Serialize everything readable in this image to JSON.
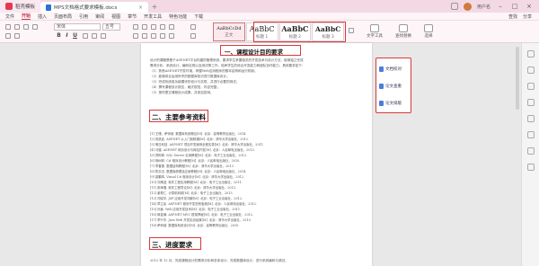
{
  "titlebar": {
    "app_name": "稻壳模板",
    "doc_name": "MPS文档格式要求模板.docx",
    "user_name": "用户名"
  },
  "menu": {
    "items": [
      "文件",
      "开始",
      "插入",
      "页面布局",
      "引用",
      "审阅",
      "视图",
      "章节",
      "开发工具",
      "特色功能",
      "下载"
    ],
    "active_index": 1,
    "right_items": [
      "查找",
      "分享"
    ]
  },
  "ribbon": {
    "font_name": "宋体",
    "font_size": "五号",
    "bold_label": "B",
    "italic_label": "I",
    "underline_label": "U",
    "styles": [
      {
        "sample": "AaBbCcDd",
        "name": "正文"
      },
      {
        "sample": "AaBbC",
        "name": "标题 1"
      },
      {
        "sample": "AaBbC",
        "name": "标题 2"
      },
      {
        "sample": "AaBbC",
        "name": "标题 3"
      }
    ],
    "right_tools": [
      "文字工具",
      "查找替换",
      "选择"
    ]
  },
  "document": {
    "section_top_title": "一、课程设计目的要求",
    "para1": [
      "设计的课题是基于ASP.NET平台构建的管理系统，要求学生掌握相关的开发技术与设计方法，能够独立完成",
      "需求分析、系统设计、编码实现以及测试等工作，培养学生的综合开发能力和团队协作能力，具体要求如下：",
      "（1）熟悉ASP.NET开发环境，掌握Web应用程序的基本结构和运行机制；",
      "（2）能够综合运用所学的数据库知识进行数据库设计；",
      "（3）完成系统各功能模块的设计与实现，并进行必要的测试；",
      "（4）撰写课程设计报告，格式规范，内容完整；",
      "（5）按时提交课程设计成果，并参加答辩。"
    ],
    "section2_title": "二、主要参考资料",
    "refs": [
      "[1] 王珊，萨师煊. 数据库系统概论[M]. 北京：高等教育出版社，2014.",
      "[2] 张跃廷. ASP.NET 从入门到精通[M]. 北京：清华大学出版社，2012.",
      "[3] 明日科技. ASP.NET 项目开发案例全程实录[M]. 北京：清华大学出版社，2011.",
      "[4] 马骏. ASP.NET 网页设计与网站开发[M]. 北京：人民邮电出版社，2013.",
      "[5] 郑阿奇. SQL Server 实用教程[M]. 北京：电子工业出版社，2012.",
      "[6] 杨树林. C# 程序设计教程[M]. 北京：人民邮电出版社，2010.",
      "[7] 李春葆. 数据结构教程[M]. 北京：清华大学出版社，2013.",
      "[8] 陈志泊. 数据库原理及应用教程[M]. 北京：人民邮电出版社，2014.",
      "[9] 邵鹏鸣. Visual C# 程序设计[M]. 北京：清华大学出版社，2012.",
      "[10] 刘甫迎. 软件工程实用教程[M]. 北京：电子工业出版社，2011.",
      "[11] 张海藩. 软件工程导论[M]. 北京：清华大学出版社，2013.",
      "[12] 谢希仁. 计算机网络[M]. 北京：电子工业出版社，2013.",
      "[13] 刘晓华. JSP 应用开发详解[M]. 北京：电子工业出版社，2012.",
      "[14] 章立民. ASP.NET 程序开发范例宝典[M]. 北京：人民邮电出版社，2012.",
      "[15] 孙鑫. Web 应用开发技术[M]. 北京：电子工业出版社，2011.",
      "[16] 蒋金楠. ASP.NET MVC 框架揭秘[M]. 北京：电子工业出版社，2012.",
      "[17] 李兴华. Java Web 开发实战经典[M]. 北京：清华大学出版社，2010.",
      "[18] 萨师煊. 数据库系统设计[M]. 北京：高等教育出版社，2010."
    ],
    "section3_title": "三、进度要求",
    "last_line": "2012 年 12 月，完成课程设计的需求分析和总体设计，完成数据库设计，进行系统编码与调试。"
  },
  "side_panel": {
    "items": [
      "文档校对",
      "论文查重",
      "论文排版"
    ]
  }
}
